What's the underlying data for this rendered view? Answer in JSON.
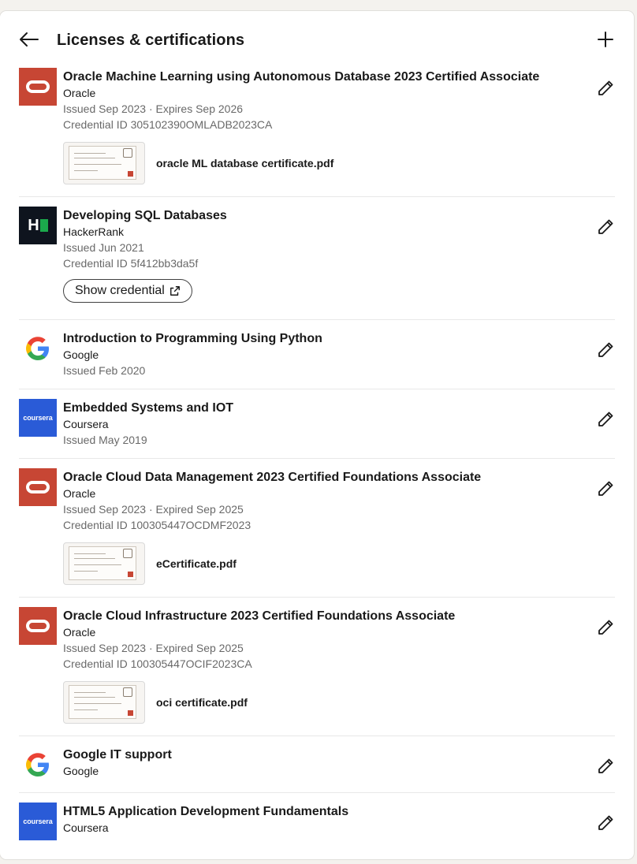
{
  "header": {
    "title": "Licenses & certifications"
  },
  "items": [
    {
      "name": "Oracle Machine Learning using Autonomous Database 2023 Certified Associate",
      "issuer": "Oracle",
      "dates": "Issued Sep 2023 · Expires Sep 2026",
      "credential_id": "Credential ID 305102390OMLADB2023CA",
      "attachment": "oracle ML database certificate.pdf"
    },
    {
      "name": "Developing SQL Databases",
      "issuer": "HackerRank",
      "dates": "Issued Jun 2021",
      "credential_id": "Credential ID 5f412bb3da5f",
      "button": "Show credential",
      "logo_text": "H"
    },
    {
      "name": "Introduction to Programming Using Python",
      "issuer": "Google",
      "dates": "Issued Feb 2020"
    },
    {
      "name": "Embedded Systems and IOT",
      "issuer": "Coursera",
      "dates": "Issued May 2019",
      "logo_text": "coursera"
    },
    {
      "name": "Oracle Cloud Data Management 2023 Certified Foundations Associate",
      "issuer": "Oracle",
      "dates": "Issued Sep 2023 · Expired Sep 2025",
      "credential_id": "Credential ID 100305447OCDMF2023",
      "attachment": "eCertificate.pdf"
    },
    {
      "name": "Oracle Cloud Infrastructure 2023 Certified Foundations Associate",
      "issuer": "Oracle",
      "dates": "Issued Sep 2023 · Expired Sep 2025",
      "credential_id": "Credential ID 100305447OCIF2023CA",
      "attachment": "oci certificate.pdf"
    },
    {
      "name": "Google IT support",
      "issuer": "Google"
    },
    {
      "name": "HTML5 Application Development Fundamentals",
      "issuer": "Coursera",
      "logo_text": "coursera"
    }
  ],
  "colors": {
    "oracle": "#c74634",
    "hackerrank": "#0e141e",
    "hackerrank_accent": "#1ba94c",
    "coursera": "#2a5bd7"
  },
  "icons": {
    "back": "arrow-left-icon",
    "add": "plus-icon",
    "edit": "pencil-icon",
    "external": "external-link-icon"
  }
}
